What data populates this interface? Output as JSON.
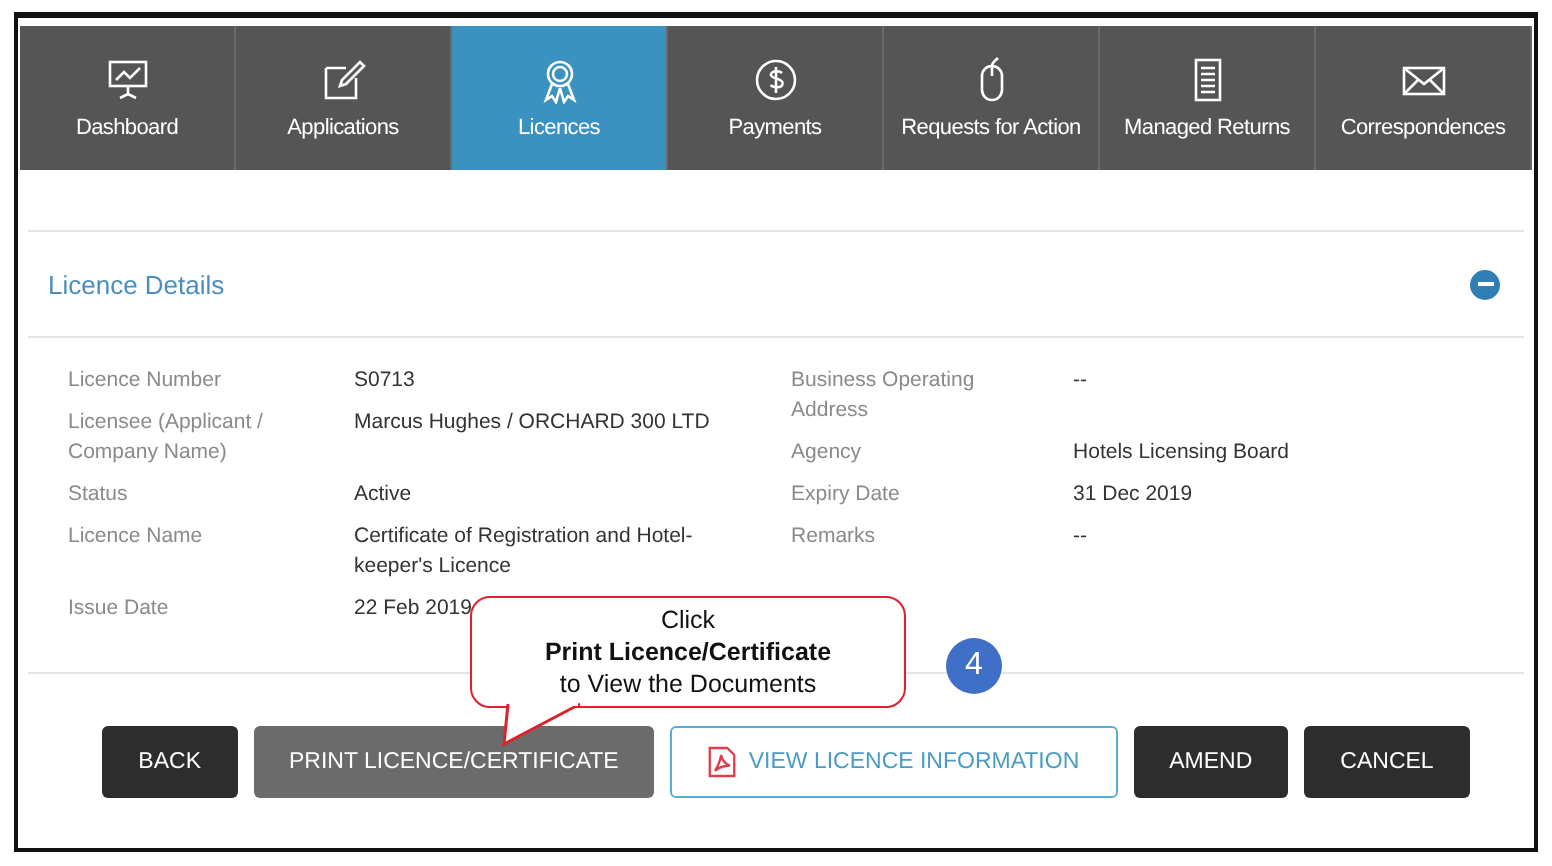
{
  "nav": [
    {
      "label": "Dashboard",
      "kind": "presentation",
      "selected": false
    },
    {
      "label": "Applications",
      "kind": "edit",
      "selected": false
    },
    {
      "label": "Licences",
      "kind": "award",
      "selected": true
    },
    {
      "label": "Payments",
      "kind": "dollar",
      "selected": false
    },
    {
      "label": "Requests for Action",
      "kind": "mouse",
      "selected": false
    },
    {
      "label": "Managed Returns",
      "kind": "document",
      "selected": false
    },
    {
      "label": "Correspondences",
      "kind": "mail",
      "selected": false
    }
  ],
  "panel": {
    "title": "Licence Details",
    "expanded": true,
    "left": [
      {
        "label": "Licence Number",
        "value": "S0713"
      },
      {
        "label": "Licensee (Applicant / Company Name)",
        "value": "Marcus Hughes / ORCHARD 300 LTD"
      },
      {
        "label": "Status",
        "value": "Active"
      },
      {
        "label": "Licence Name",
        "value": "Certificate of Registration and Hotel-keeper's Licence"
      },
      {
        "label": "Issue Date",
        "value": "22 Feb 2019"
      }
    ],
    "right": [
      {
        "label": "Business Operating Address",
        "value": "--"
      },
      {
        "label": "Agency",
        "value": "Hotels Licensing Board"
      },
      {
        "label": "Expiry Date",
        "value": "31 Dec 2019"
      },
      {
        "label": "Remarks",
        "value": "--"
      }
    ]
  },
  "buttons": [
    {
      "label": "BACK",
      "kind": "dark"
    },
    {
      "label": "PRINT LICENCE/CERTIFICATE",
      "kind": "grey"
    },
    {
      "label": "VIEW LICENCE INFORMATION",
      "kind": "outline"
    },
    {
      "label": "AMEND",
      "kind": "dark"
    },
    {
      "label": "CANCEL",
      "kind": "dark"
    }
  ],
  "callout": {
    "lines": [
      "Click",
      "Print Licence/Certificate",
      "to View the Documents"
    ],
    "step": "4"
  }
}
